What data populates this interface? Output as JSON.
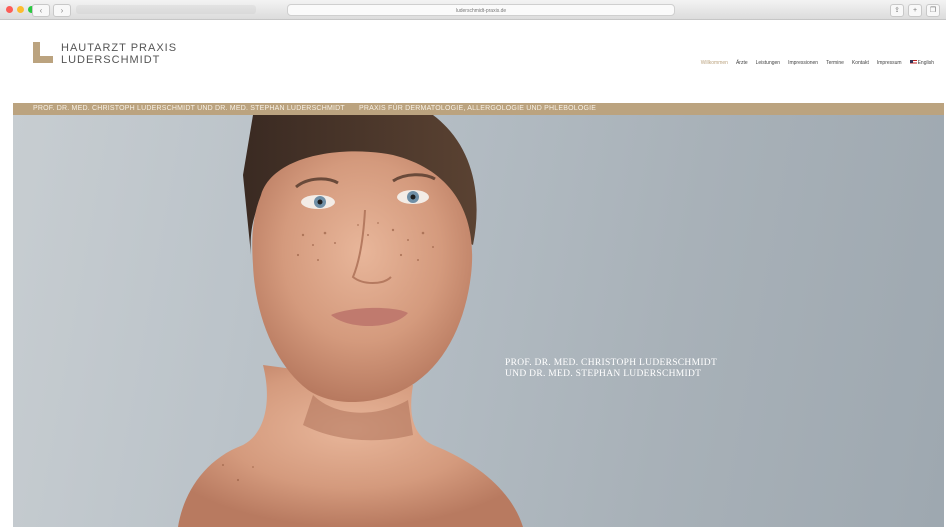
{
  "browser": {
    "url": "luderschmidt-praxis.de",
    "back_icon": "chevron-left-icon",
    "forward_icon": "chevron-right-icon"
  },
  "logo": {
    "line1": "HAUTARZT PRAXIS",
    "line2": "LUDERSCHMIDT"
  },
  "nav": {
    "items": [
      "Willkommen",
      "Ärzte",
      "Leistungen",
      "Impressionen",
      "Termine",
      "Kontakt",
      "Impressum",
      "English"
    ]
  },
  "band": {
    "left": "PROF. DR. MED. CHRISTOPH LUDERSCHMIDT UND DR. MED. STEPHAN LUDERSCHMIDT",
    "right": "PRAXIS FÜR DERMATOLOGIE, ALLERGOLOGIE UND PHLEBOLOGIE"
  },
  "hero": {
    "caption_line1": "PROF. DR. MED. CHRISTOPH  LUDERSCHMIDT",
    "caption_line2": "UND DR. MED. STEPHAN LUDERSCHMIDT"
  },
  "colors": {
    "accent": "#bba37f",
    "band_text": "#f7f1e6"
  }
}
